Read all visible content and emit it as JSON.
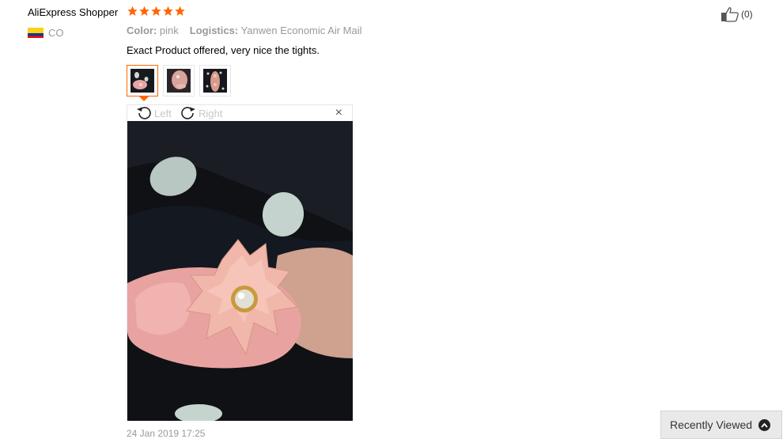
{
  "reviewer": {
    "name": "AliExpress Shopper",
    "country_code": "CO",
    "flag_colors": [
      "#FCD116",
      "#003893",
      "#CE1126"
    ]
  },
  "rating": {
    "stars": 5,
    "max": 5,
    "color": "#f60"
  },
  "order_info": {
    "color_label": "Color:",
    "color_value": "pink",
    "logistics_label": "Logistics:",
    "logistics_value": "Yanwen Economic Air Mail"
  },
  "review": {
    "text": "Exact Product offered, very nice the tights."
  },
  "thumbnails": [
    {
      "name": "photo-1",
      "selected": true
    },
    {
      "name": "photo-2",
      "selected": false
    },
    {
      "name": "photo-3",
      "selected": false
    }
  ],
  "viewer": {
    "rotate_left_label": "Left",
    "rotate_right_label": "Right",
    "close_label": "×"
  },
  "date": "24 Jan 2019 17:25",
  "helpful": {
    "count": "(0)"
  },
  "recently_viewed": {
    "label": "Recently Viewed"
  },
  "colors": {
    "accent": "#ff6600",
    "muted": "#999999"
  }
}
